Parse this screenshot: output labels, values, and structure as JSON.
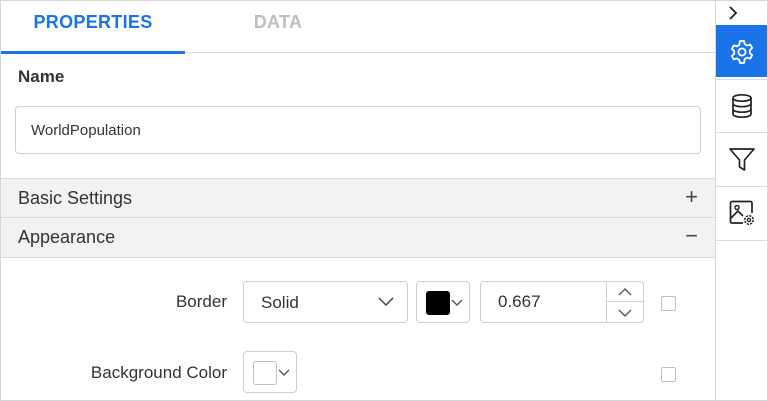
{
  "tabs": [
    {
      "label": "PROPERTIES",
      "active": true
    },
    {
      "label": "DATA",
      "active": false
    }
  ],
  "name": {
    "label": "Name",
    "value": "WorldPopulation"
  },
  "sections": {
    "basic_settings": {
      "title": "Basic Settings",
      "toggle": "+",
      "expanded": false
    },
    "appearance": {
      "title": "Appearance",
      "toggle": "−",
      "expanded": true
    }
  },
  "appearance": {
    "border": {
      "label": "Border",
      "style": "Solid",
      "color": "#000000",
      "width": "0.667"
    },
    "background": {
      "label": "Background Color",
      "color": "#ffffff"
    }
  },
  "rail": {
    "collapse_icon": "chevron-right-icon",
    "items": [
      {
        "icon": "gear-icon",
        "active": true
      },
      {
        "icon": "database-icon",
        "active": false
      },
      {
        "icon": "filter-icon",
        "active": false
      },
      {
        "icon": "image-settings-icon",
        "active": false
      }
    ]
  },
  "colors": {
    "accent": "#1a73e8",
    "inactive_tab": "#bdbdbd",
    "section_bg": "#f2f2f2"
  }
}
